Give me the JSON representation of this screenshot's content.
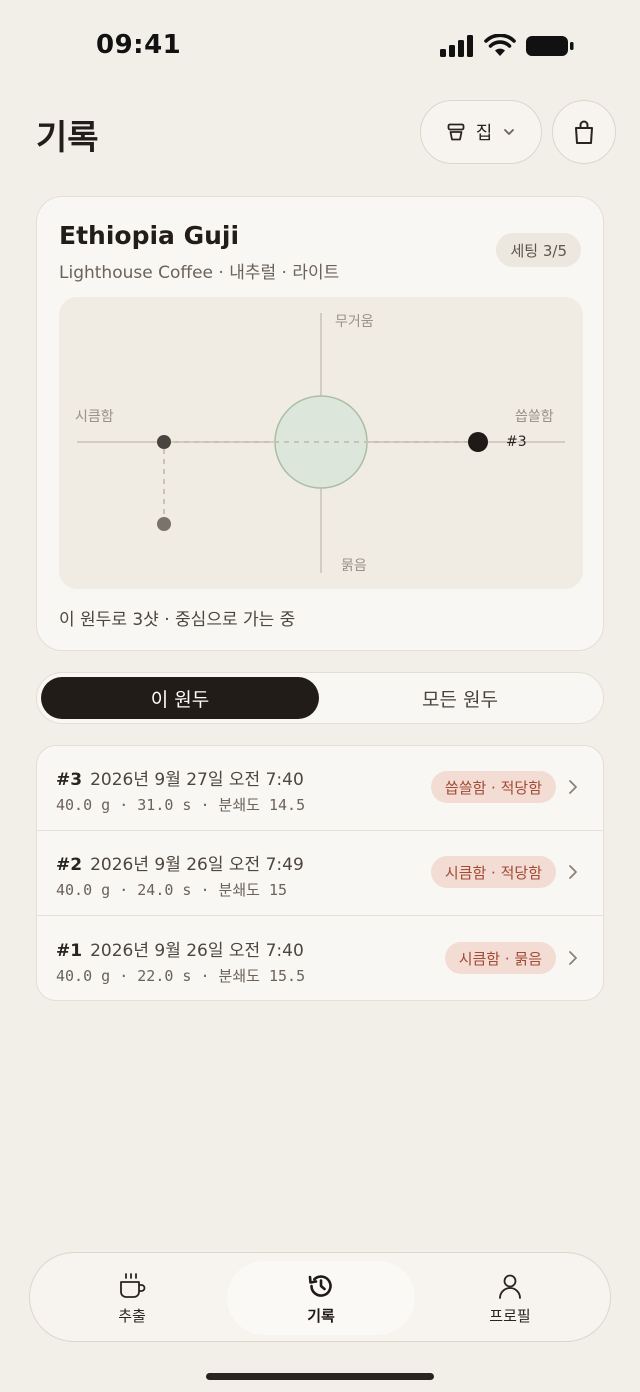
{
  "status_bar": {
    "time": "09:41"
  },
  "header": {
    "title": "기록",
    "location_label": "집"
  },
  "bean_card": {
    "name": "Ethiopia Guji",
    "subtitle": "Lighthouse Coffee · 내추럴 · 라이트",
    "setting_badge": "세팅 3/5",
    "axes": {
      "top": "무거움",
      "bottom": "묽음",
      "left": "시큼함",
      "right": "씁쓸함"
    },
    "current_shot_label": "#3",
    "progress_text": "이 원두로 3샷 · 중심으로 가는 중"
  },
  "segmented": {
    "active": "이 원두",
    "inactive": "모든 원두"
  },
  "history": [
    {
      "number": "#3",
      "date": "2026년 9월 27일 오전 7:40",
      "stats": "40.0 g · 31.0 s · 분쇄도 14.5",
      "tag": "씁쓸함 · 적당함"
    },
    {
      "number": "#2",
      "date": "2026년 9월 26일 오전 7:49",
      "stats": "40.0 g · 24.0 s · 분쇄도 15",
      "tag": "시큼함 · 적당함"
    },
    {
      "number": "#1",
      "date": "2026년 9월 26일 오전 7:40",
      "stats": "40.0 g · 22.0 s · 분쇄도 15.5",
      "tag": "시큼함 · 묽음"
    }
  ],
  "bottom_nav": [
    {
      "label": "추출",
      "icon": "coffee-cup-icon"
    },
    {
      "label": "기록",
      "icon": "history-icon",
      "active": true
    },
    {
      "label": "프로필",
      "icon": "person-icon"
    }
  ]
}
